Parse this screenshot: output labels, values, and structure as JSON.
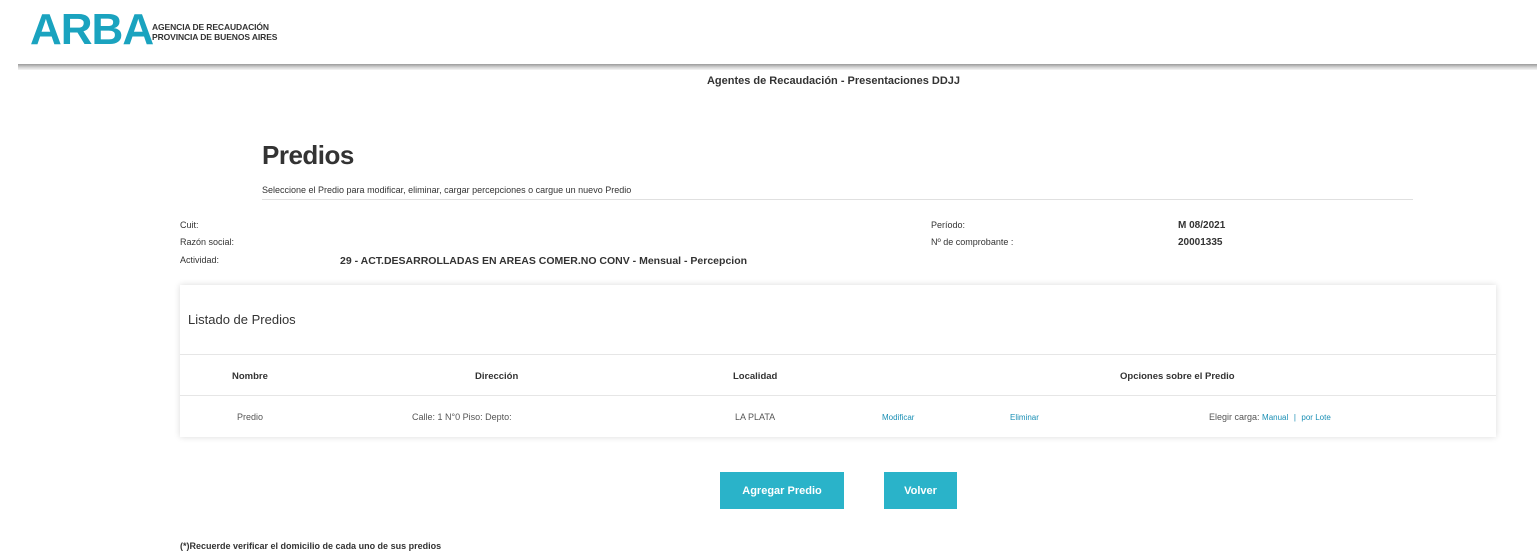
{
  "header": {
    "logo": "ARBA",
    "agency_line1": "AGENCIA DE RECAUDACIÓN",
    "agency_line2": "PROVINCIA DE BUENOS AIRES",
    "section_title": "Agentes de Recaudación - Presentaciones DDJJ"
  },
  "page": {
    "title": "Predios",
    "subtitle": "Seleccione el Predio para modificar, eliminar, cargar percepciones o cargue un nuevo Predio"
  },
  "info": {
    "cuit_label": "Cuit:",
    "razon_social_label": "Razón social:",
    "actividad_label": "Actividad:",
    "actividad_value": "29 - ACT.DESARROLLADAS EN AREAS COMER.NO CONV - Mensual - Percepcion",
    "periodo_label": "Período:",
    "periodo_value": "M 08/2021",
    "comprobante_label": "Nº de comprobante :",
    "comprobante_value": "20001335"
  },
  "table": {
    "title": "Listado de Predios",
    "headers": {
      "nombre": "Nombre",
      "direccion": "Dirección",
      "localidad": "Localidad",
      "opciones": "Opciones sobre el Predio"
    },
    "rows": [
      {
        "nombre": "Predio",
        "direccion": "Calle: 1 N°0 Piso: Depto:",
        "localidad": "LA PLATA",
        "modificar": "Modificar",
        "eliminar": "Eliminar",
        "elegir_carga": "Elegir carga:",
        "manual": "Manual",
        "separator": "|",
        "por_lote": "por Lote"
      }
    ]
  },
  "buttons": {
    "agregar": "Agregar Predio",
    "volver": "Volver"
  },
  "footnote": "(*)Recuerde verificar el domicilio de cada uno de sus predios",
  "colors": {
    "brand": "#1aa3bf",
    "button": "#2ab3c9",
    "link": "#1a8fb5"
  }
}
